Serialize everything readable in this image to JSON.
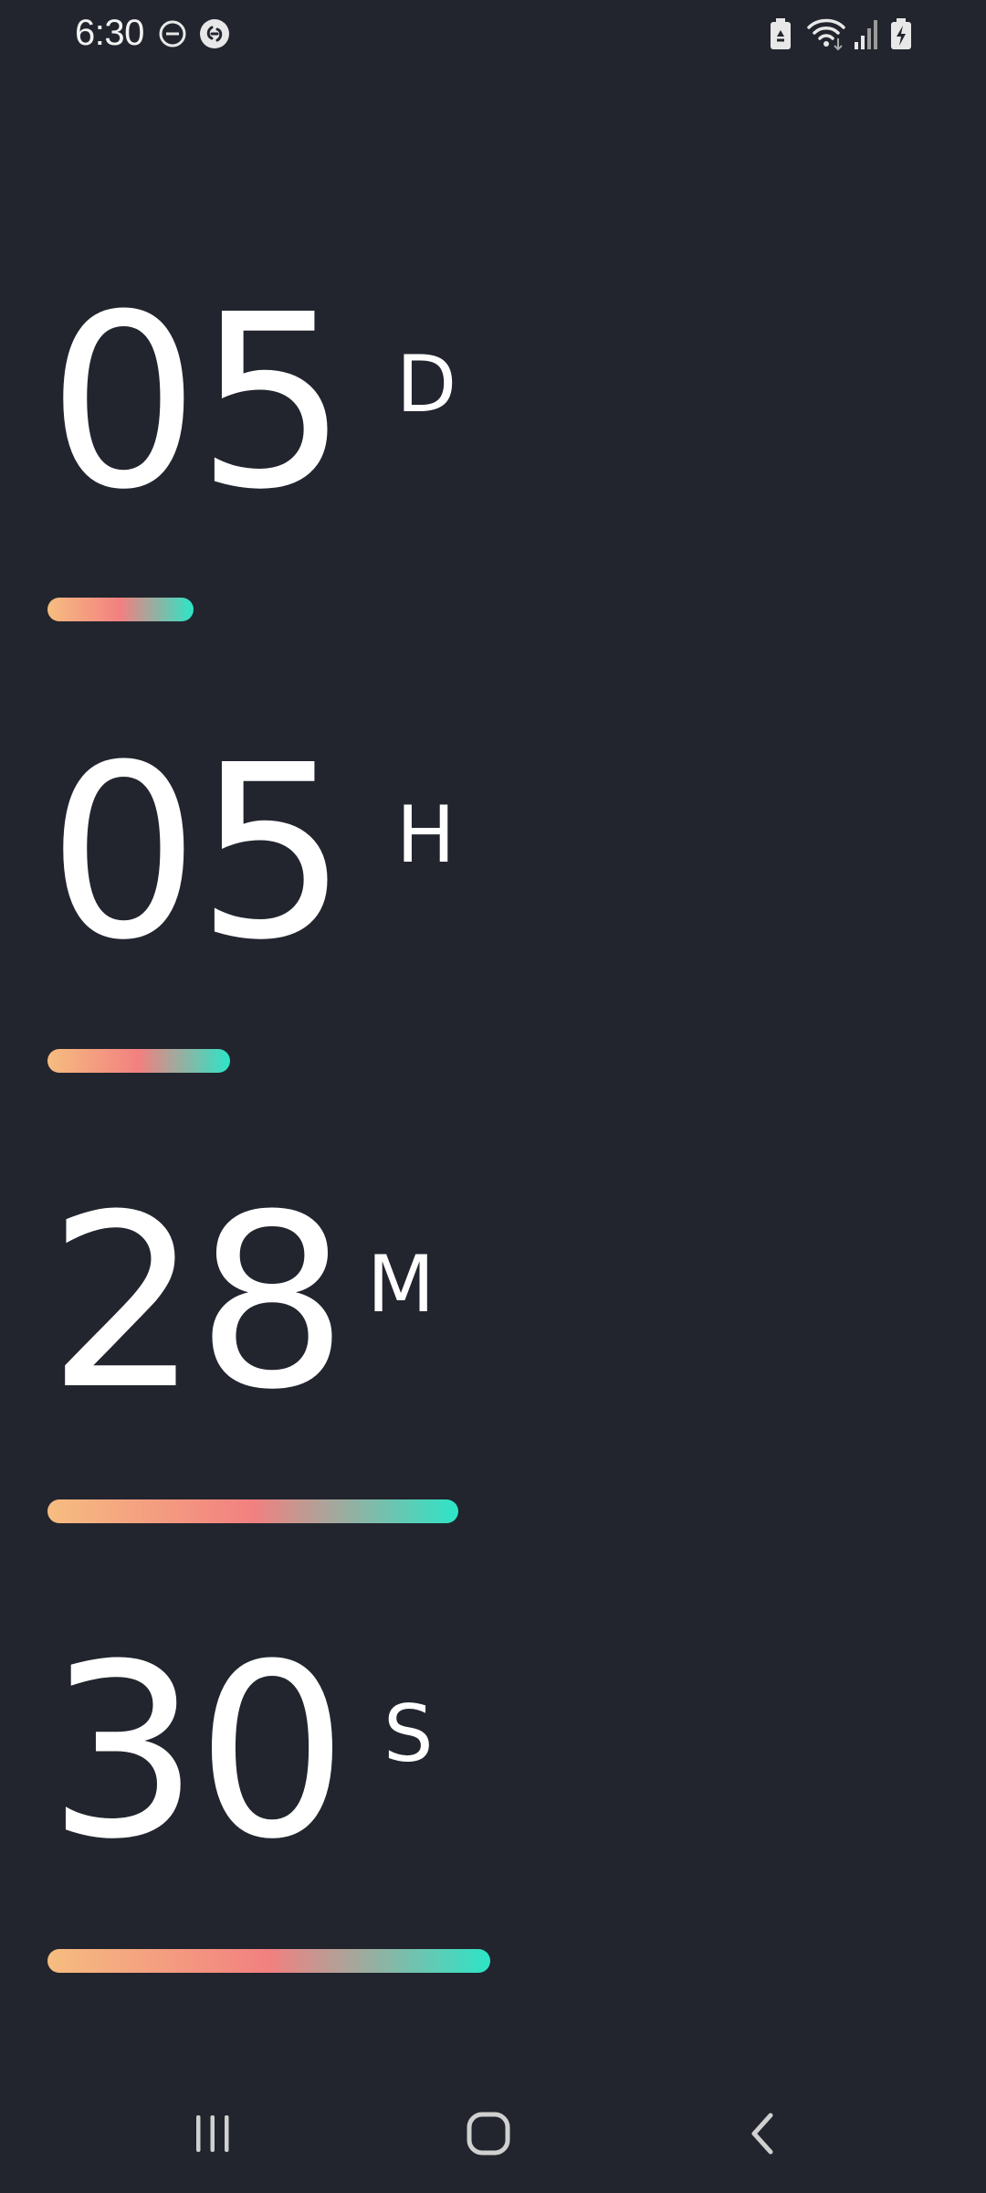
{
  "status_bar": {
    "time": "6:30",
    "left_icons": [
      "do-not-disturb-icon",
      "shazam-icon"
    ],
    "right_icons": [
      "battery-saver-icon",
      "wifi-icon",
      "signal-icon",
      "battery-charging-icon"
    ]
  },
  "countdown": [
    {
      "name": "days",
      "value": "05",
      "unit": "D",
      "progress": 0.32
    },
    {
      "name": "hours",
      "value": "05",
      "unit": "H",
      "progress": 0.4
    },
    {
      "name": "minutes",
      "value": "28",
      "unit": "M",
      "progress": 0.9
    },
    {
      "name": "seconds",
      "value": "30",
      "unit": "S",
      "progress": 0.97
    }
  ],
  "gradient": {
    "start": "#f6bd80",
    "middle": "#f28080",
    "end": "#2de5c7"
  },
  "nav_bar": {
    "buttons": [
      "recent-apps-icon",
      "home-icon",
      "back-icon"
    ]
  }
}
